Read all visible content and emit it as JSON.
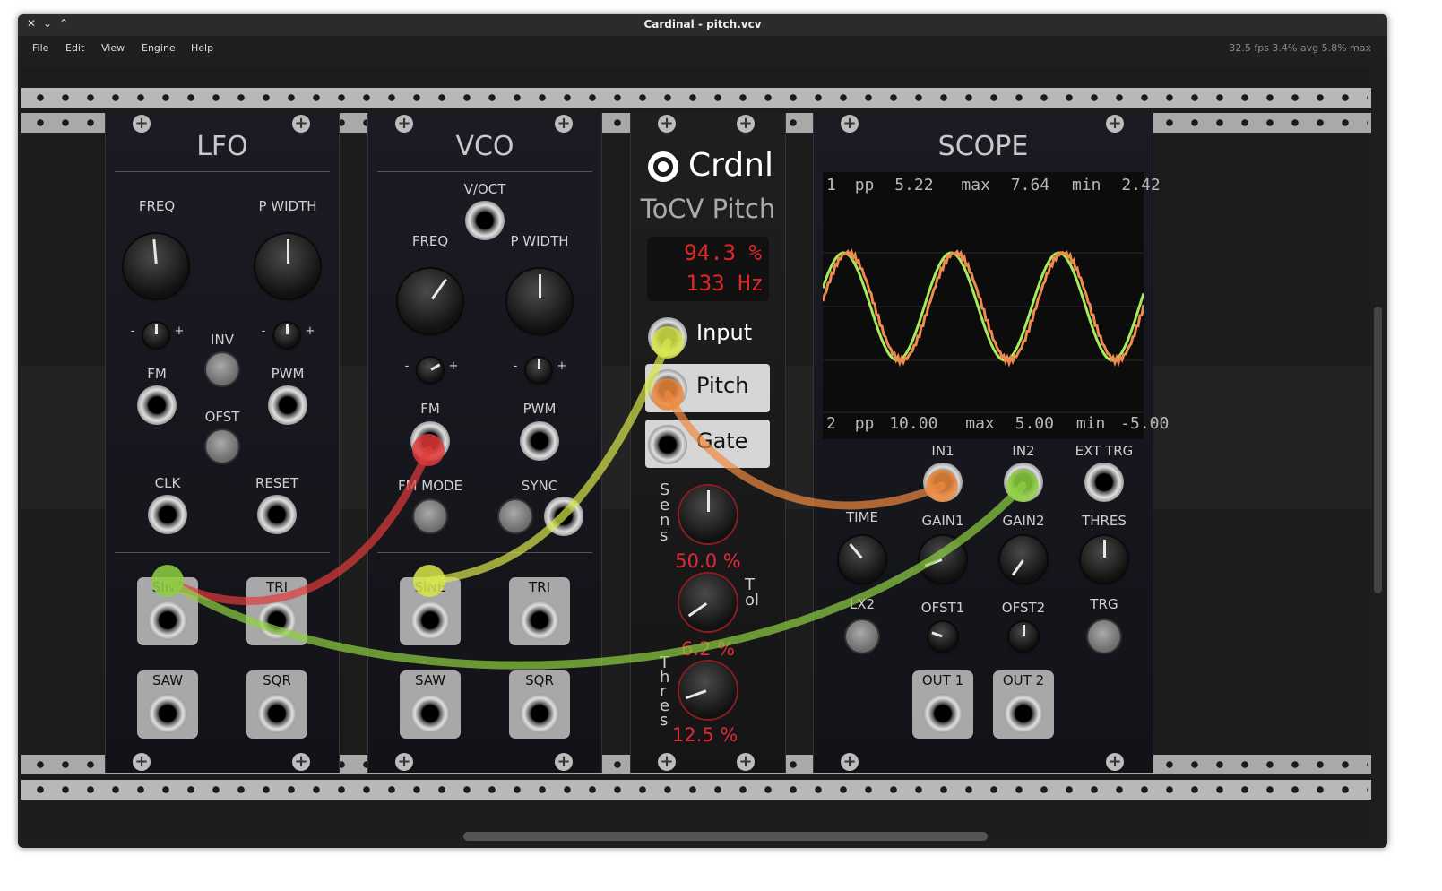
{
  "window": {
    "title": "Cardinal - pitch.vcv",
    "close": "✕",
    "min": "⌄",
    "max": "⌃"
  },
  "menu": [
    "File",
    "Edit",
    "View",
    "Engine",
    "Help"
  ],
  "stats": "32.5 fps  3.4% avg  5.8% max",
  "lfo": {
    "title": "LFO",
    "labels": {
      "freq": "FREQ",
      "pwidth": "P WIDTH",
      "inv": "INV",
      "fm": "FM",
      "pwm": "PWM",
      "ofst": "OFST",
      "clk": "CLK",
      "reset": "RESET",
      "minus": "-",
      "plus": "+"
    },
    "outputs": [
      "SINE",
      "TRI",
      "SAW",
      "SQR"
    ]
  },
  "vco": {
    "title": "VCO",
    "labels": {
      "voct": "V/OCT",
      "freq": "FREQ",
      "pwidth": "P WIDTH",
      "fm": "FM",
      "pwm": "PWM",
      "fmmode": "FM MODE",
      "sync": "SYNC",
      "minus": "-",
      "plus": "+"
    },
    "outputs": [
      "SINE",
      "TRI",
      "SAW",
      "SQR"
    ]
  },
  "tocv": {
    "brand": "Crdnl",
    "name": "ToCV Pitch",
    "display_line1": "94.3 %",
    "display_line2": "133 Hz",
    "ports": [
      "Input",
      "Pitch",
      "Gate"
    ],
    "sens_label": "Sens",
    "sens_value": "50.0 %",
    "tol_label": "Tol",
    "tol_value": "6.2 %",
    "thres_label": "Thres",
    "thres_value": "12.5 %",
    "value_color": "#e02a3a"
  },
  "scope": {
    "title": "SCOPE",
    "ch1": {
      "idx": "1",
      "pp_l": "pp",
      "pp": "5.22",
      "max_l": "max",
      "max": "7.64",
      "min_l": "min",
      "min": "2.42"
    },
    "ch2": {
      "idx": "2",
      "pp_l": "pp",
      "pp": "10.00",
      "max_l": "max",
      "max": "5.00",
      "min_l": "min",
      "min": "-5.00"
    },
    "labels": {
      "in1": "IN1",
      "in2": "IN2",
      "exttrg": "EXT TRG",
      "time": "TIME",
      "gain1": "GAIN1",
      "gain2": "GAIN2",
      "thres": "THRES",
      "lx2": "LX2",
      "ofst1": "OFST1",
      "ofst2": "OFST2",
      "trg": "TRG"
    },
    "outputs": [
      "OUT 1",
      "OUT 2"
    ],
    "trace1_color": "#f08a50",
    "trace2_color": "#a6ec5a"
  },
  "cable_colors": {
    "red": "#e03a3a",
    "yellow": "#d8e64a",
    "orange": "#ef8a3e",
    "green": "#8ed042"
  }
}
